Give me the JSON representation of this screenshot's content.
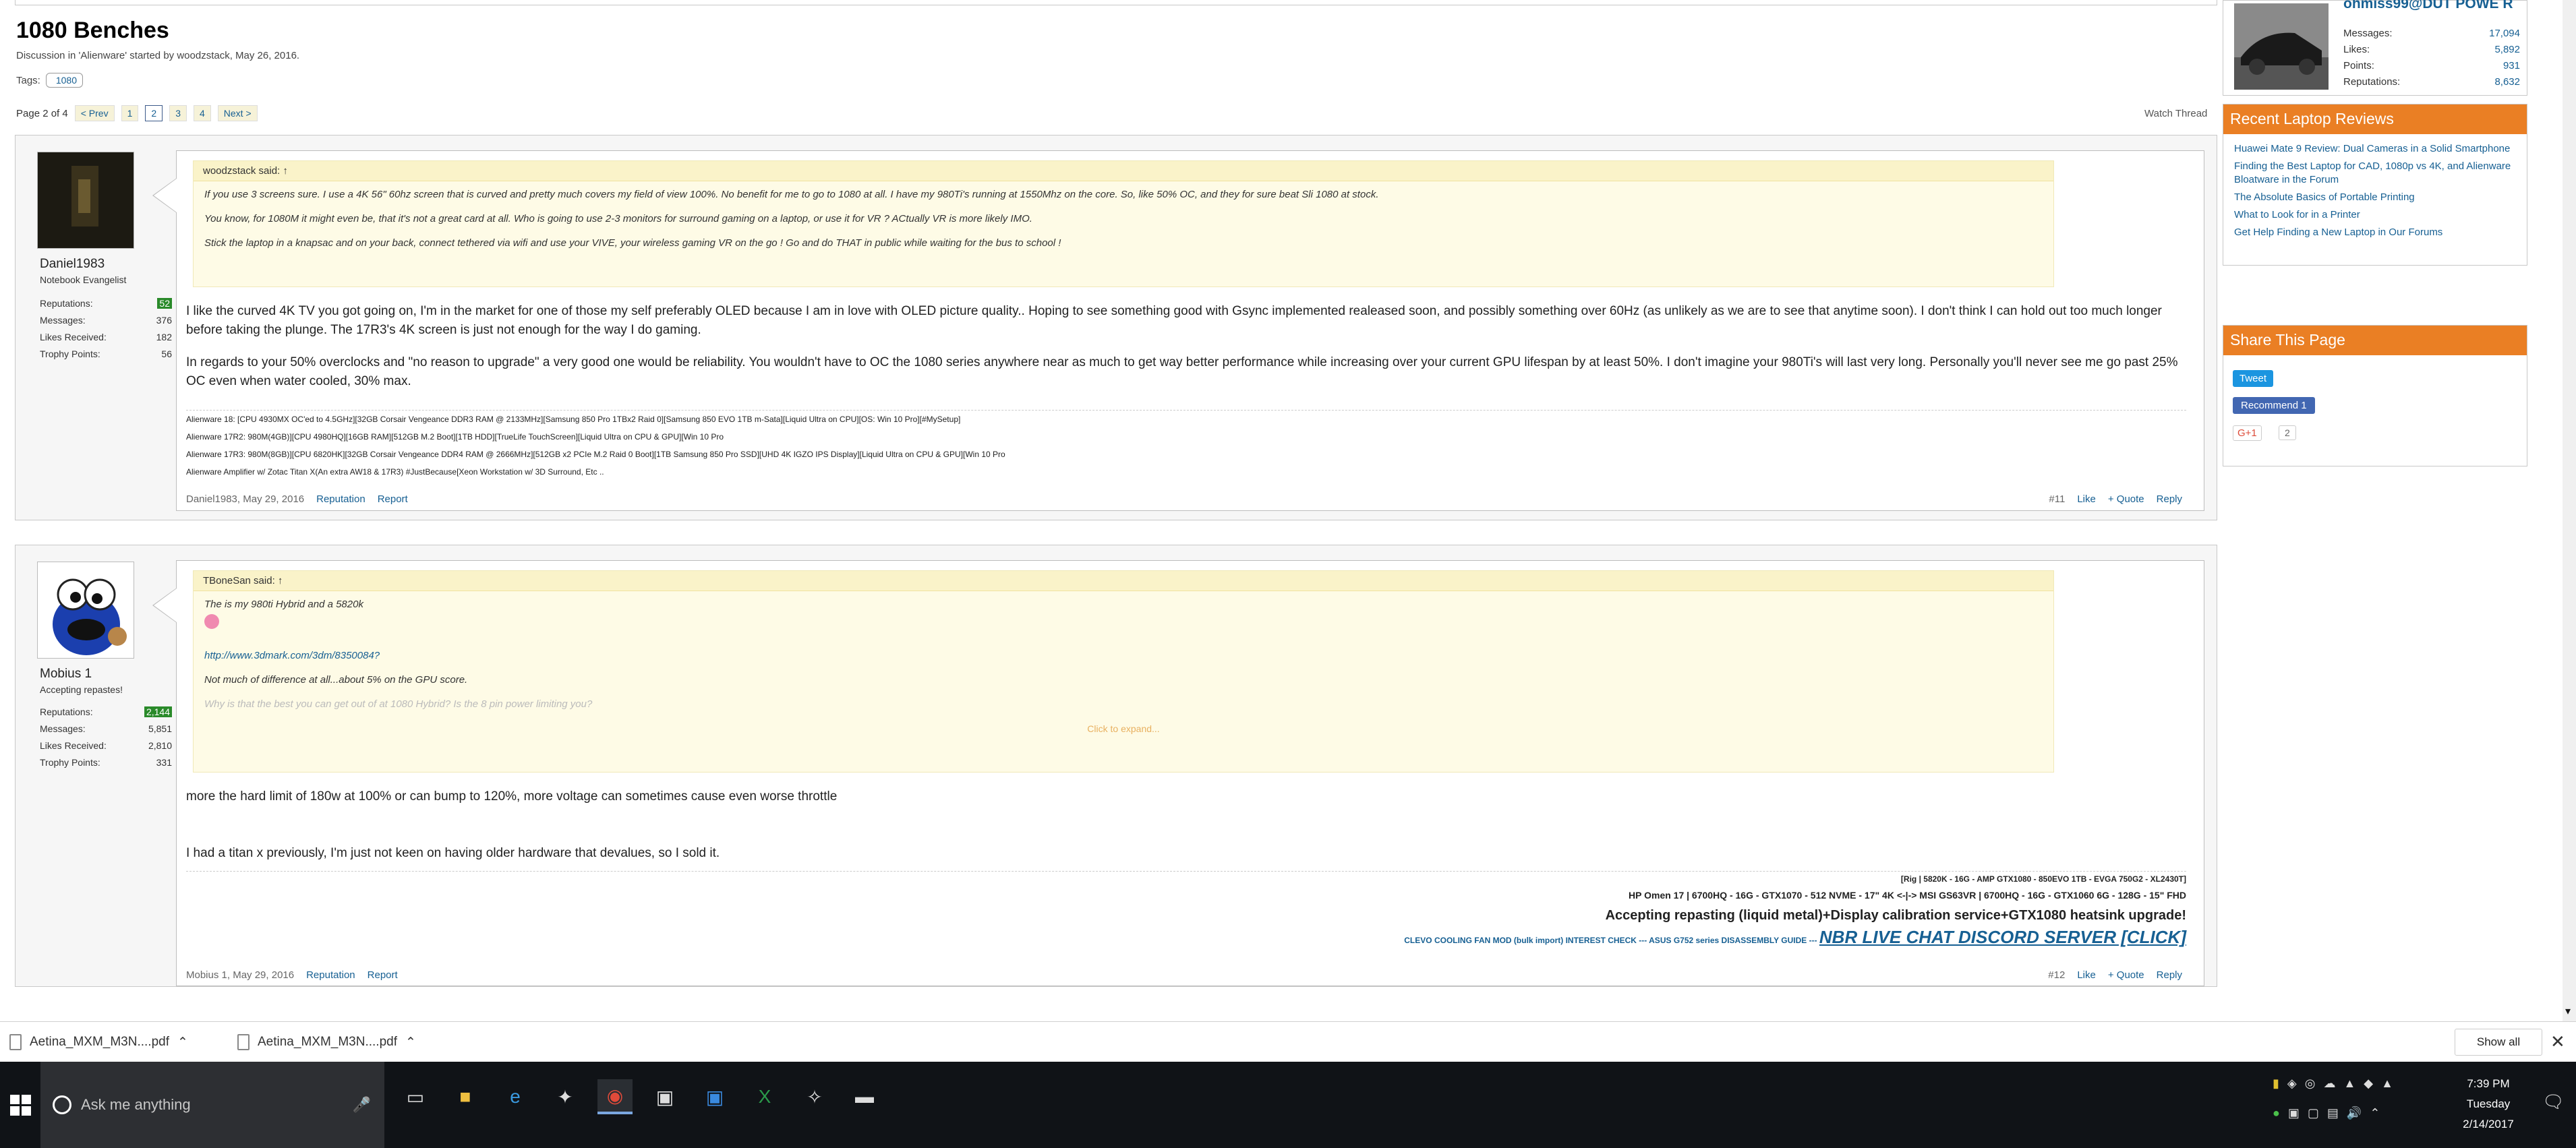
{
  "thread": {
    "title": "1080 Benches",
    "discussion": "Discussion in 'Alienware' started by woodzstack, May 26, 2016.",
    "tags_label": "Tags:",
    "tag": "1080"
  },
  "pagenav": {
    "label": "Page 2 of 4",
    "prev": "< Prev",
    "pages": [
      "1",
      "2",
      "3",
      "4"
    ],
    "next": "Next >",
    "watch": "Watch Thread"
  },
  "posts": [
    {
      "user": "Daniel1983",
      "title": "Notebook Evangelist",
      "stats": [
        {
          "k": "Reputations:",
          "v": "52"
        },
        {
          "k": "Messages:",
          "v": "376"
        },
        {
          "k": "Likes Received:",
          "v": "182"
        },
        {
          "k": "Trophy Points:",
          "v": "56"
        }
      ],
      "quote_head": "woodzstack said: ↑",
      "quote": [
        "If you use 3 screens sure. I use a 4K 56\" 60hz screen that is curved and pretty much covers my field of view 100%. No benefit for me to go to 1080 at all. I have my 980Ti's running at 1550Mhz on the core. So, like 50% OC, and they for sure beat Sli 1080 at stock.",
        "You know, for 1080M it might even be, that it's not a great card at all. Who is going to use 2-3 monitors for surround gaming on a laptop, or use it for VR ? ACtually VR is more likely IMO.",
        "Stick the laptop in a knapsac and on your back, connect tethered via wifi and use your VIVE, your wireless gaming VR on the go ! Go and do THAT in public while waiting for the bus to school !"
      ],
      "body": [
        "I like the curved 4K TV you got going on, I'm in the market for one of those my self preferably OLED because I am in love with OLED picture quality.. Hoping to see something good with Gsync implemented realeased soon, and possibly something over 60Hz (as unlikely as we are to see that anytime soon). I don't think I can hold out too much longer before taking the plunge. The 17R3's 4K screen is just not enough for the way I do gaming.",
        "In regards to your 50% overclocks and \"no reason to upgrade\" a very good one would be reliability. You wouldn't have to OC the 1080 series anywhere near as much to get way better performance while increasing over your current GPU lifespan by at least 50%. I don't imagine your 980Ti's will last very long. Personally you'll never see me go past 25% OC even when water cooled, 30% max."
      ],
      "sig": [
        "Alienware 18: [CPU 4930MX OC'ed to 4.5GHz][32GB Corsair Vengeance DDR3 RAM @ 2133MHz][Samsung 850 Pro 1TBx2 Raid 0][Samsung 850 EVO 1TB m-Sata][Liquid Ultra on CPU][OS: Win 10 Pro][#MySetup]",
        "Alienware 17R2: 980M(4GB)][CPU 4980HQ][16GB RAM][512GB M.2 Boot][1TB HDD][TrueLife TouchScreen][Liquid Ultra on CPU & GPU][Win 10 Pro",
        "Alienware 17R3: 980M(8GB)][CPU 6820HK][32GB Corsair Vengeance DDR4 RAM @ 2666MHz][512GB x2 PCIe M.2 Raid 0 Boot][1TB Samsung 850 Pro SSD][UHD 4K IGZO IPS Display][Liquid Ultra on CPU & GPU][Win 10 Pro",
        "Alienware Amplifier w/ Zotac Titan X(An extra AW18 & 17R3) #JustBecause[Xeon Workstation w/ 3D Surround, Etc .."
      ],
      "meta": "Daniel1983, May 29, 2016",
      "reputation": "Reputation",
      "report": "Report",
      "num": "#11",
      "like": "Like",
      "quote_btn": "+ Quote",
      "reply": "Reply"
    },
    {
      "user": "Mobius 1",
      "title": "Accepting repastes!",
      "stats": [
        {
          "k": "Reputations:",
          "v": "2,144"
        },
        {
          "k": "Messages:",
          "v": "5,851"
        },
        {
          "k": "Likes Received:",
          "v": "2,810"
        },
        {
          "k": "Trophy Points:",
          "v": "331"
        }
      ],
      "quote_head": "TBoneSan said: ↑",
      "quote": [
        "The is my 980ti Hybrid and a 5820k",
        "http://www.3dmark.com/3dm/8350084?",
        "Not much of difference at all...about 5% on the GPU score.",
        "Why is that the best you can get out of at 1080 Hybrid? Is the 8 pin power limiting you?"
      ],
      "expand": "Click to expand...",
      "body": [
        "more the hard limit of 180w at 100% or can bump to 120%, more voltage can sometimes cause even worse throttle",
        "I had a titan x previously, I'm just not keen on having older hardware that devalues, so I sold it."
      ],
      "sig": [
        "[Rig | 5820K - 16G - AMP GTX1080 - 850EVO 1TB - EVGA 750G2 - XL2430T]",
        "HP Omen 17 | 6700HQ - 16G - GTX1070 - 512 NVME - 17\" 4K <-|-> MSI GS63VR | 6700HQ - 16G - GTX1060 6G - 128G - 15\" FHD",
        "Accepting repasting (liquid metal)+Display calibration service+GTX1080 heatsink upgrade!",
        "CLEVO COOLING FAN MOD (bulk import) INTEREST CHECK --- ASUS G752 series DISASSEMBLY GUIDE ---",
        "NBR LIVE CHAT DISCORD SERVER [CLICK]"
      ],
      "meta": "Mobius 1, May 29, 2016",
      "reputation": "Reputation",
      "report": "Report",
      "num": "#12",
      "like": "Like",
      "quote_btn": "+ Quote",
      "reply": "Reply"
    }
  ],
  "sidebar": {
    "profile_name": "ohmiss99@DUT POWE R",
    "profile_stats": [
      {
        "k": "Messages:",
        "v": "17,094"
      },
      {
        "k": "Likes:",
        "v": "5,892"
      },
      {
        "k": "Points:",
        "v": "931"
      },
      {
        "k": "Reputations:",
        "v": "8,632"
      }
    ],
    "reviews_title": "Recent Laptop Reviews",
    "reviews": [
      "Huawei Mate 9 Review: Dual Cameras in a Solid Smartphone",
      "Finding the Best Laptop for CAD, 1080p vs 4K, and Alienware Bloatware in the Forum",
      "The Absolute Basics of Portable Printing",
      "What to Look for in a Printer",
      "Get Help Finding a New Laptop in Our Forums"
    ],
    "share_title": "Share This Page",
    "tweet": "Tweet",
    "recommend": "Recommend 1",
    "gplus": "G+1",
    "gcount": "2"
  },
  "downloads": {
    "items": [
      "Aetina_MXM_M3N....pdf",
      "Aetina_MXM_M3N....pdf"
    ],
    "show_all": "Show all"
  },
  "taskbar": {
    "search": "Ask me anything",
    "time": "7:39 PM",
    "day": "Tuesday",
    "date": "2/14/2017"
  }
}
